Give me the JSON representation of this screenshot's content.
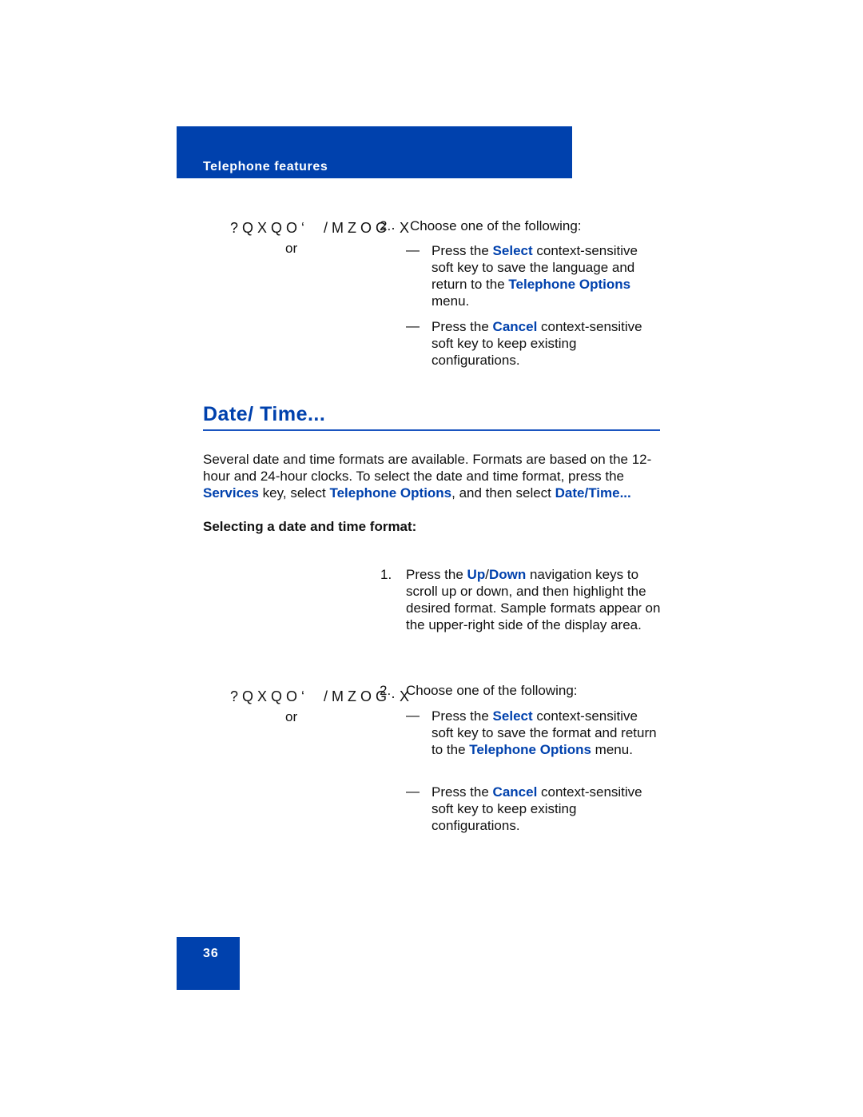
{
  "header": {
    "title": "Telephone features"
  },
  "step_glyphs": {
    "left": "?QXQO‘",
    "right": "/MZOG·X",
    "or": "or"
  },
  "block1": {
    "num": "2.",
    "intro": "Choose one of the following:",
    "opt1": {
      "a": "Press the ",
      "k1": "Select",
      "b": " context-sensitive soft key to save the language and return to the ",
      "k2": "Telephone Options",
      "c": " menu."
    },
    "opt2": {
      "a": "Press the ",
      "k1": "Cancel",
      "b": " context-sensitive soft key to keep existing configurations."
    }
  },
  "section": {
    "title": "Date/ Time...",
    "p1": "Several date and time formats are available. Formats are based on the 12-hour and 24-hour clocks. To select the date and time format, press the ",
    "k1": "Services",
    "p2": " key, select ",
    "k2": "Telephone Options",
    "p3": ", and then select ",
    "k3": "Date/Time...",
    "subhead": "Selecting a date and time format:"
  },
  "step1": {
    "num": "1.",
    "a": "Press the ",
    "k1": "Up",
    "slash": "/",
    "k2": "Down",
    "b": " navigation keys to scroll up or down, and then highlight the desired format. Sample formats appear on the upper-right side of the display area."
  },
  "block2": {
    "num": "2.",
    "intro": "Choose one of the following:",
    "opt1": {
      "a": "Press the ",
      "k1": "Select",
      "b": " context-sensitive soft key to save the format and return to the ",
      "k2": "Telephone Options",
      "c": " menu."
    },
    "opt2": {
      "a": "Press the ",
      "k1": "Cancel",
      "b": " context-sensitive soft key to keep existing configurations."
    }
  },
  "dash": "—",
  "page_number": "36"
}
